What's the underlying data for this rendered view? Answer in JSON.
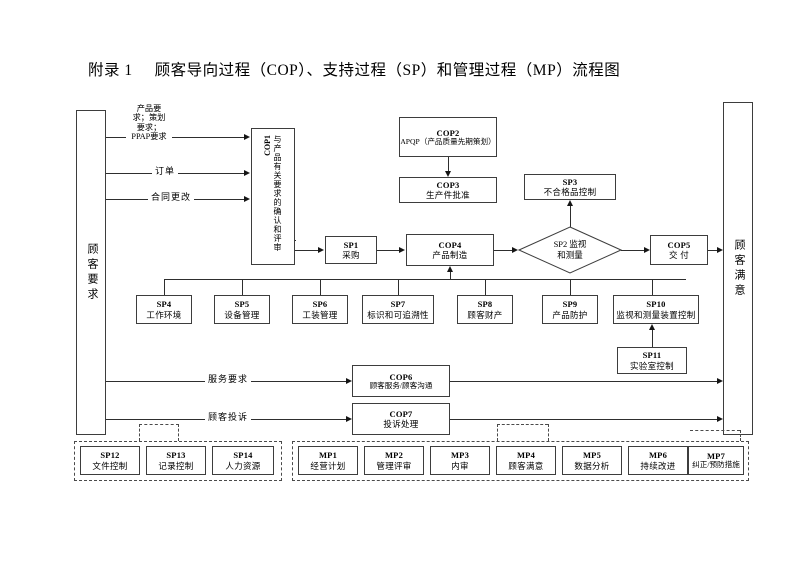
{
  "title": {
    "number": "附录 1",
    "text": "顾客导向过程（COP）、支持过程（SP）和管理过程（MP）流程图"
  },
  "endpoints": {
    "left": "顾客要求",
    "right": "顾客满意"
  },
  "input_labels": {
    "requirements": "产品要求；策划要求；PPAP要求",
    "order": "订单",
    "contract_change": "合同更改",
    "service_request": "服务要求",
    "customer_complaint": "顾客投诉"
  },
  "processes": {
    "cop1": {
      "code": "COP1",
      "name": "与产品有关要求的确认和评审"
    },
    "cop2": {
      "code": "COP2",
      "name": "APQP（产品质量先期策划）"
    },
    "cop3": {
      "code": "COP3",
      "name": "生产件批准"
    },
    "cop4": {
      "code": "COP4",
      "name": "产品制造"
    },
    "cop5": {
      "code": "COP5",
      "name": "交 付"
    },
    "cop6": {
      "code": "COP6",
      "name": "顾客服务/顾客沟通"
    },
    "cop7": {
      "code": "COP7",
      "name": "投诉处理"
    },
    "sp1": {
      "code": "SP1",
      "name": "采购"
    },
    "sp2": {
      "code": "SP2 监视",
      "name": "和测量"
    },
    "sp3": {
      "code": "SP3",
      "name": "不合格品控制"
    },
    "sp4": {
      "code": "SP4",
      "name": "工作环境"
    },
    "sp5": {
      "code": "SP5",
      "name": "设备管理"
    },
    "sp6": {
      "code": "SP6",
      "name": "工装管理"
    },
    "sp7": {
      "code": "SP7",
      "name": "标识和可追溯性"
    },
    "sp8": {
      "code": "SP8",
      "name": "顾客财产"
    },
    "sp9": {
      "code": "SP9",
      "name": "产品防护"
    },
    "sp10": {
      "code": "SP10",
      "name": "监视和测量装置控制"
    },
    "sp11": {
      "code": "SP11",
      "name": "实验室控制"
    },
    "sp12": {
      "code": "SP12",
      "name": "文件控制"
    },
    "sp13": {
      "code": "SP13",
      "name": "记录控制"
    },
    "sp14": {
      "code": "SP14",
      "name": "人力资源"
    },
    "mp1": {
      "code": "MP1",
      "name": "经营计划"
    },
    "mp2": {
      "code": "MP2",
      "name": "管理评审"
    },
    "mp3": {
      "code": "MP3",
      "name": "内审"
    },
    "mp4": {
      "code": "MP4",
      "name": "顾客满意"
    },
    "mp5": {
      "code": "MP5",
      "name": "数据分析"
    },
    "mp6": {
      "code": "MP6",
      "name": "持续改进"
    },
    "mp7": {
      "code": "MP7",
      "name": "纠正/预防措施"
    }
  },
  "colors": {
    "line": "#2e2e2e",
    "box_border": "#3d3d3d",
    "background": "#ffffff"
  }
}
